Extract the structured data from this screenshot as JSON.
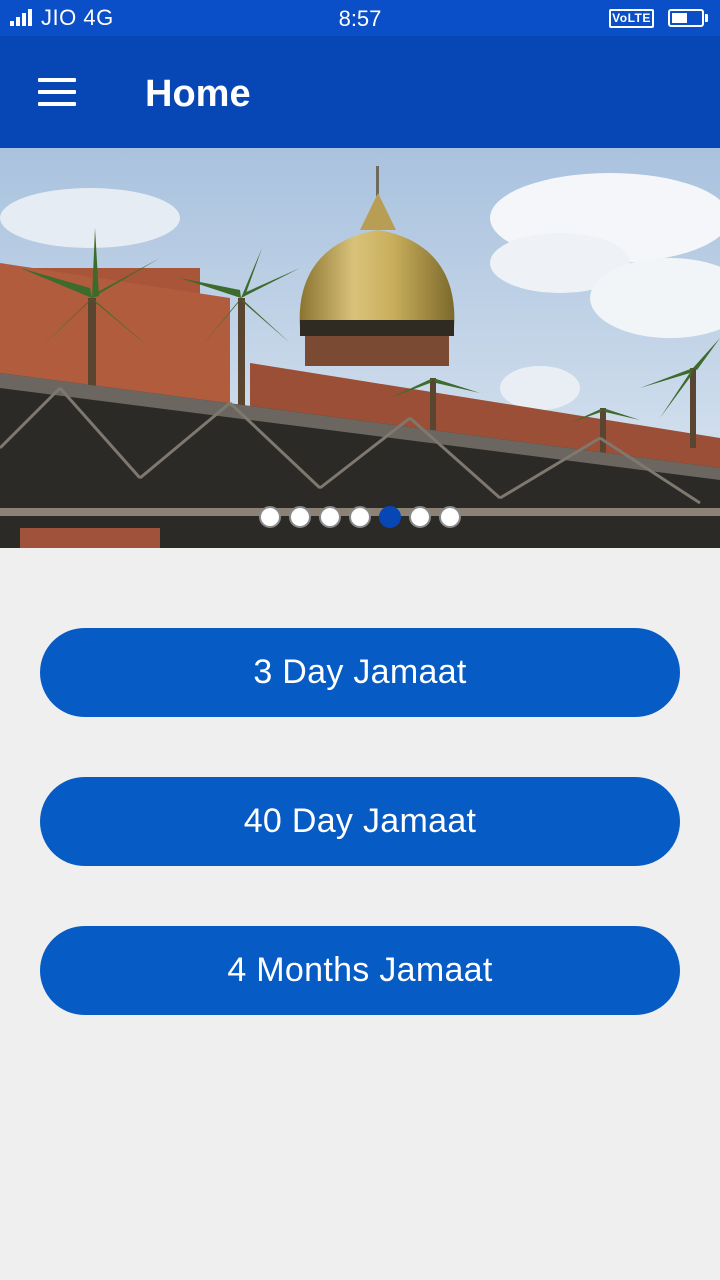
{
  "status_bar": {
    "carrier": "JIO 4G",
    "time": "8:57",
    "volte": "VoLTE",
    "battery_level": 0.55
  },
  "app_bar": {
    "title": "Home",
    "menu_icon": "hamburger-menu-icon"
  },
  "carousel": {
    "slide_count": 7,
    "active_index": 4,
    "image": "mosque with golden dome and palm trees"
  },
  "buttons": [
    {
      "label": "3 Day Jamaat"
    },
    {
      "label": "40 Day Jamaat"
    },
    {
      "label": "4 Months Jamaat"
    }
  ],
  "colors": {
    "status_bar": "#0a4fc7",
    "app_bar": "#0747b5",
    "button": "#075bc5",
    "background": "#efefef",
    "active_dot": "#0747b5"
  }
}
